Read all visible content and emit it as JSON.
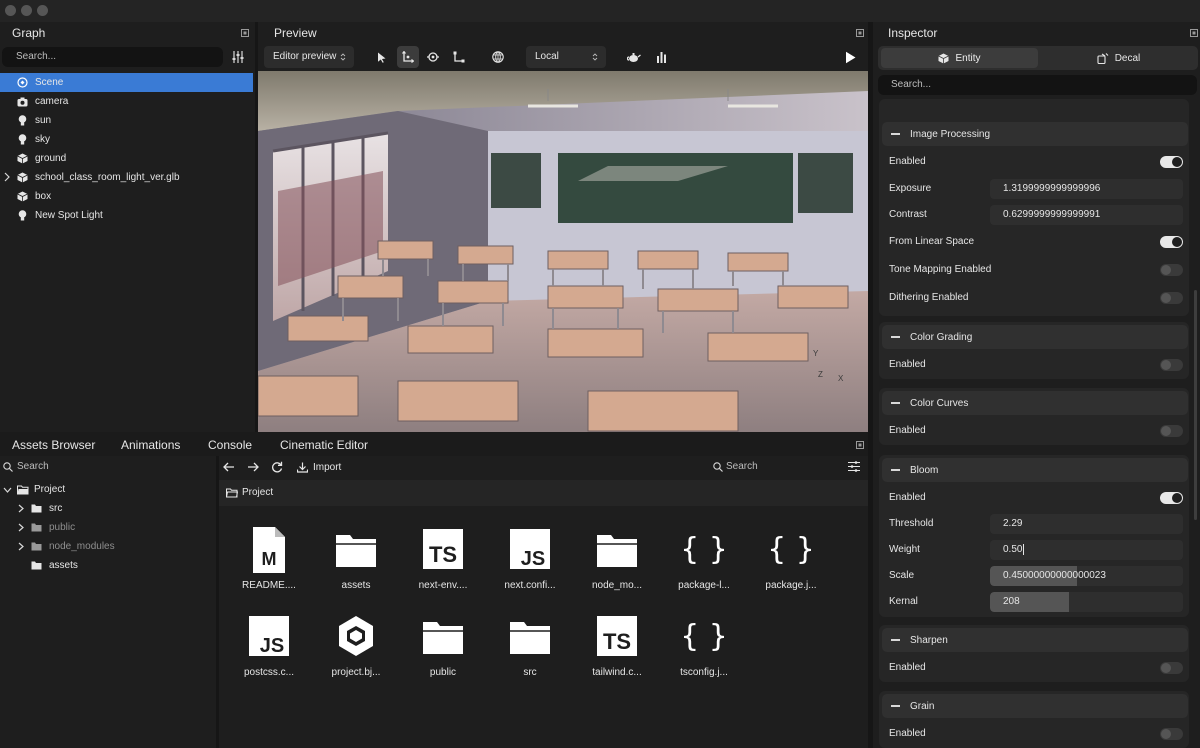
{
  "graph": {
    "tab": "Graph",
    "search_placeholder": "Search...",
    "items": [
      {
        "label": "Scene",
        "icon": "scene-icon",
        "selected": true
      },
      {
        "label": "camera",
        "icon": "camera-icon"
      },
      {
        "label": "sun",
        "icon": "light-bulb-icon"
      },
      {
        "label": "sky",
        "icon": "light-bulb-icon"
      },
      {
        "label": "ground",
        "icon": "cube-icon"
      },
      {
        "label": "school_class_room_light_ver.glb",
        "icon": "cube-icon",
        "expandable": true
      },
      {
        "label": "box",
        "icon": "cube-icon"
      },
      {
        "label": "New Spot Light",
        "icon": "light-bulb-icon"
      }
    ]
  },
  "preview": {
    "tab": "Preview",
    "camera_select": "Editor preview",
    "space_select": "Local",
    "axis_labels": {
      "y": "Y",
      "z": "Z",
      "x": "X"
    }
  },
  "bottom_tabs": [
    "Assets Browser",
    "Animations",
    "Console",
    "Cinematic Editor"
  ],
  "assets": {
    "tree_search_placeholder": "Search",
    "grid_search_placeholder": "Search",
    "import_label": "Import",
    "breadcrumb": "Project",
    "tree": [
      {
        "label": "Project",
        "level": 0,
        "expanded": true
      },
      {
        "label": "src",
        "level": 1,
        "dim": false
      },
      {
        "label": "public",
        "level": 1,
        "dim": true
      },
      {
        "label": "node_modules",
        "level": 1,
        "dim": true
      },
      {
        "label": "assets",
        "level": 1,
        "dim": false,
        "leaf": true
      }
    ],
    "files": [
      {
        "name": "README....",
        "type": "markdown"
      },
      {
        "name": "assets",
        "type": "folder"
      },
      {
        "name": "next-env....",
        "type": "ts"
      },
      {
        "name": "next.confi...",
        "type": "js"
      },
      {
        "name": "node_mo...",
        "type": "folder"
      },
      {
        "name": "package-l...",
        "type": "json"
      },
      {
        "name": "package.j...",
        "type": "json"
      },
      {
        "name": "postcss.c...",
        "type": "js"
      },
      {
        "name": "project.bj...",
        "type": "project"
      },
      {
        "name": "public",
        "type": "folder"
      },
      {
        "name": "src",
        "type": "folder"
      },
      {
        "name": "tailwind.c...",
        "type": "ts"
      },
      {
        "name": "tsconfig.j...",
        "type": "json"
      }
    ]
  },
  "inspector": {
    "tab": "Inspector",
    "entity_tab": "Entity",
    "decal_tab": "Decal",
    "search_placeholder": "Search...",
    "image_processing": {
      "title": "Image Processing",
      "enabled_label": "Enabled",
      "enabled": true,
      "exposure_label": "Exposure",
      "exposure": "1.3199999999999996",
      "contrast_label": "Contrast",
      "contrast": "0.6299999999999991",
      "linear_label": "From Linear Space",
      "linear": true,
      "tone_label": "Tone Mapping Enabled",
      "tone": false,
      "dither_label": "Dithering Enabled",
      "dither": false
    },
    "color_grading": {
      "title": "Color Grading",
      "enabled_label": "Enabled",
      "enabled": false
    },
    "color_curves": {
      "title": "Color Curves",
      "enabled_label": "Enabled",
      "enabled": false
    },
    "bloom": {
      "title": "Bloom",
      "enabled_label": "Enabled",
      "enabled": true,
      "threshold_label": "Threshold",
      "threshold": "2.29",
      "weight_label": "Weight",
      "weight": "0.50",
      "scale_label": "Scale",
      "scale": "0.45000000000000023",
      "scale_fill": 0.45,
      "kernal_label": "Kernal",
      "kernal": "208",
      "kernal_fill": 0.41
    },
    "sharpen": {
      "title": "Sharpen",
      "enabled_label": "Enabled",
      "enabled": false
    },
    "grain": {
      "title": "Grain",
      "enabled_label": "Enabled",
      "enabled": false
    }
  }
}
